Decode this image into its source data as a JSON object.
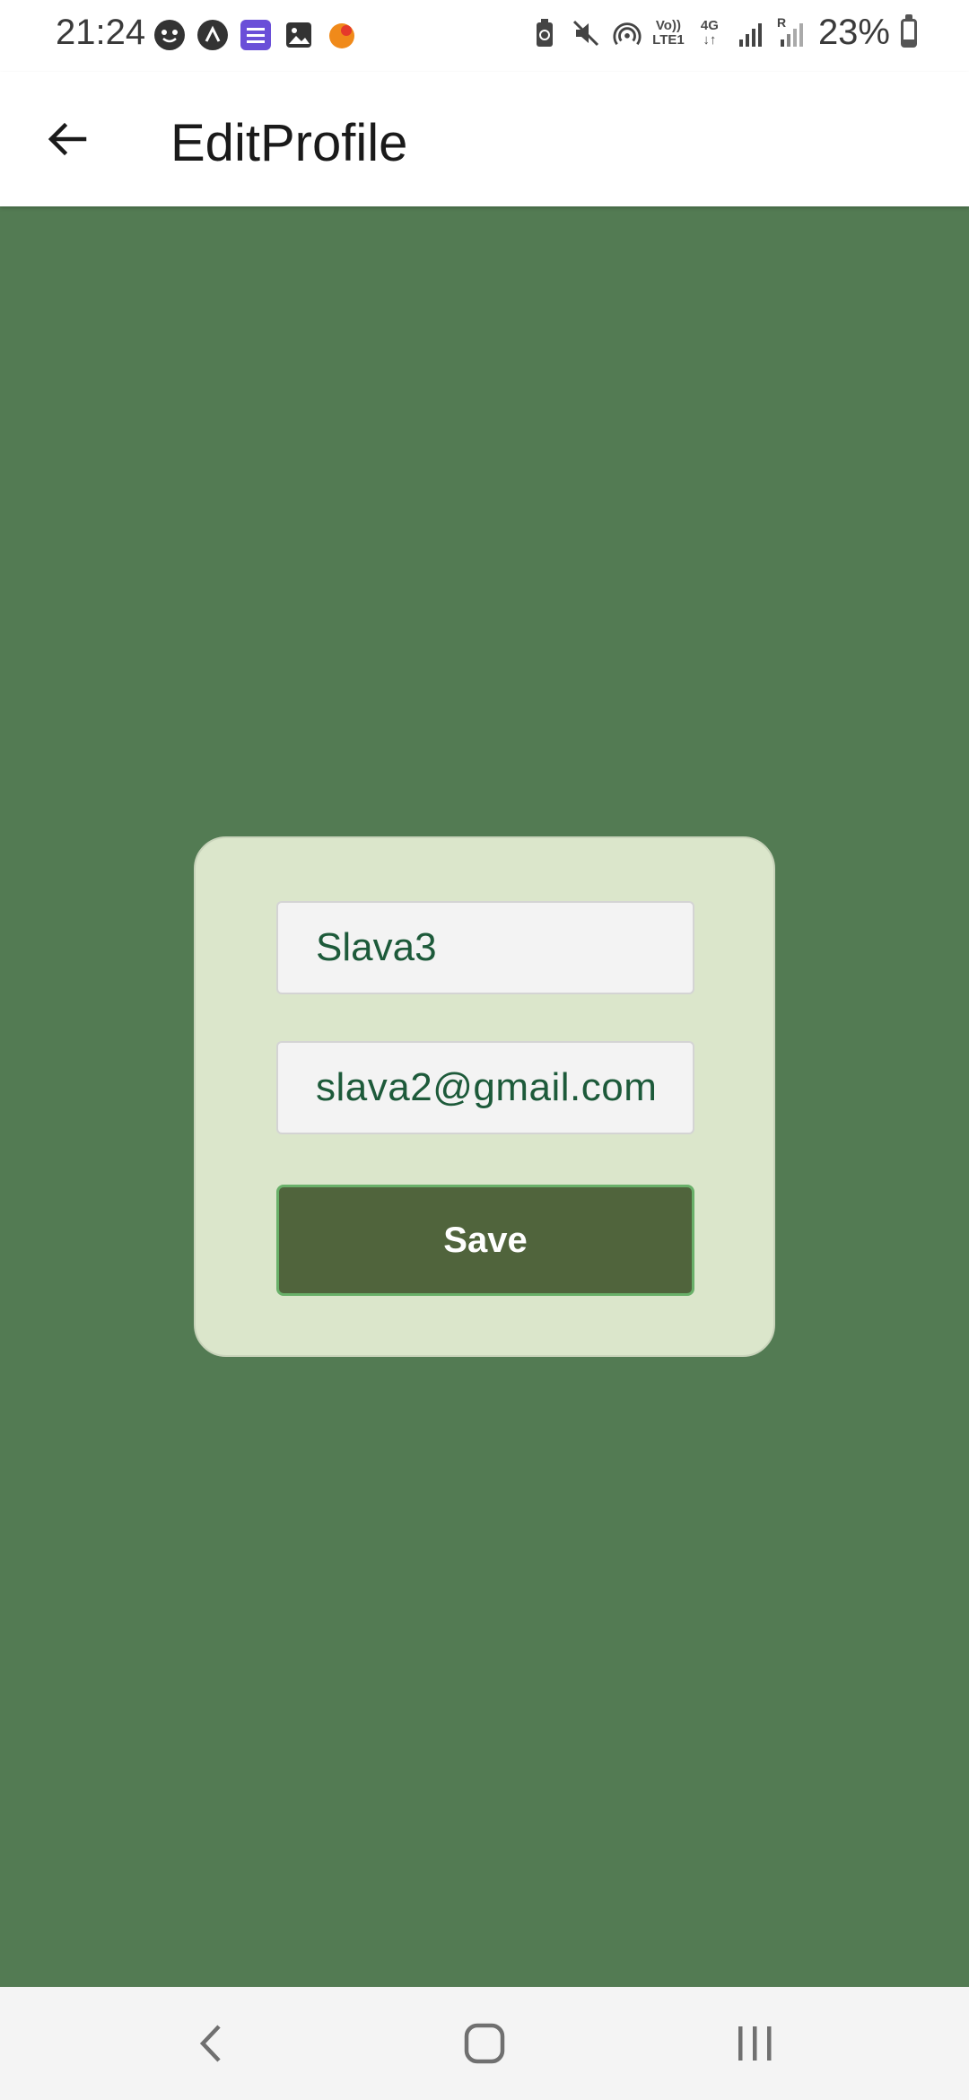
{
  "status_bar": {
    "time": "21:24",
    "signal_labels": {
      "volte": "Vo))",
      "lte": "LTE1",
      "net": "4G",
      "roaming": "R"
    },
    "battery_percent": "23%",
    "battery_level": 0.23,
    "notification_icons": [
      "face-icon",
      "arrow-up-circle-icon",
      "list-app-icon",
      "gallery-icon",
      "orange-dot-icon"
    ],
    "system_icons": [
      "battery-saver-icon",
      "mute-icon",
      "hotspot-icon",
      "volte-icon",
      "4g-icon",
      "signal-icon",
      "roaming-signal-icon"
    ]
  },
  "app_bar": {
    "title": "EditProfile",
    "back_icon": "arrow-left-icon"
  },
  "form": {
    "name_value": "Slava3",
    "email_value": "slava2@gmail.com",
    "save_label": "Save"
  },
  "colors": {
    "background": "#537b53",
    "card": "#dbe6cb",
    "button": "#50643c",
    "button_border": "#69b069",
    "field_text": "#1d5a3a"
  },
  "nav_bar": {
    "items": [
      "back-nav-icon",
      "home-nav-icon",
      "recents-nav-icon"
    ]
  }
}
